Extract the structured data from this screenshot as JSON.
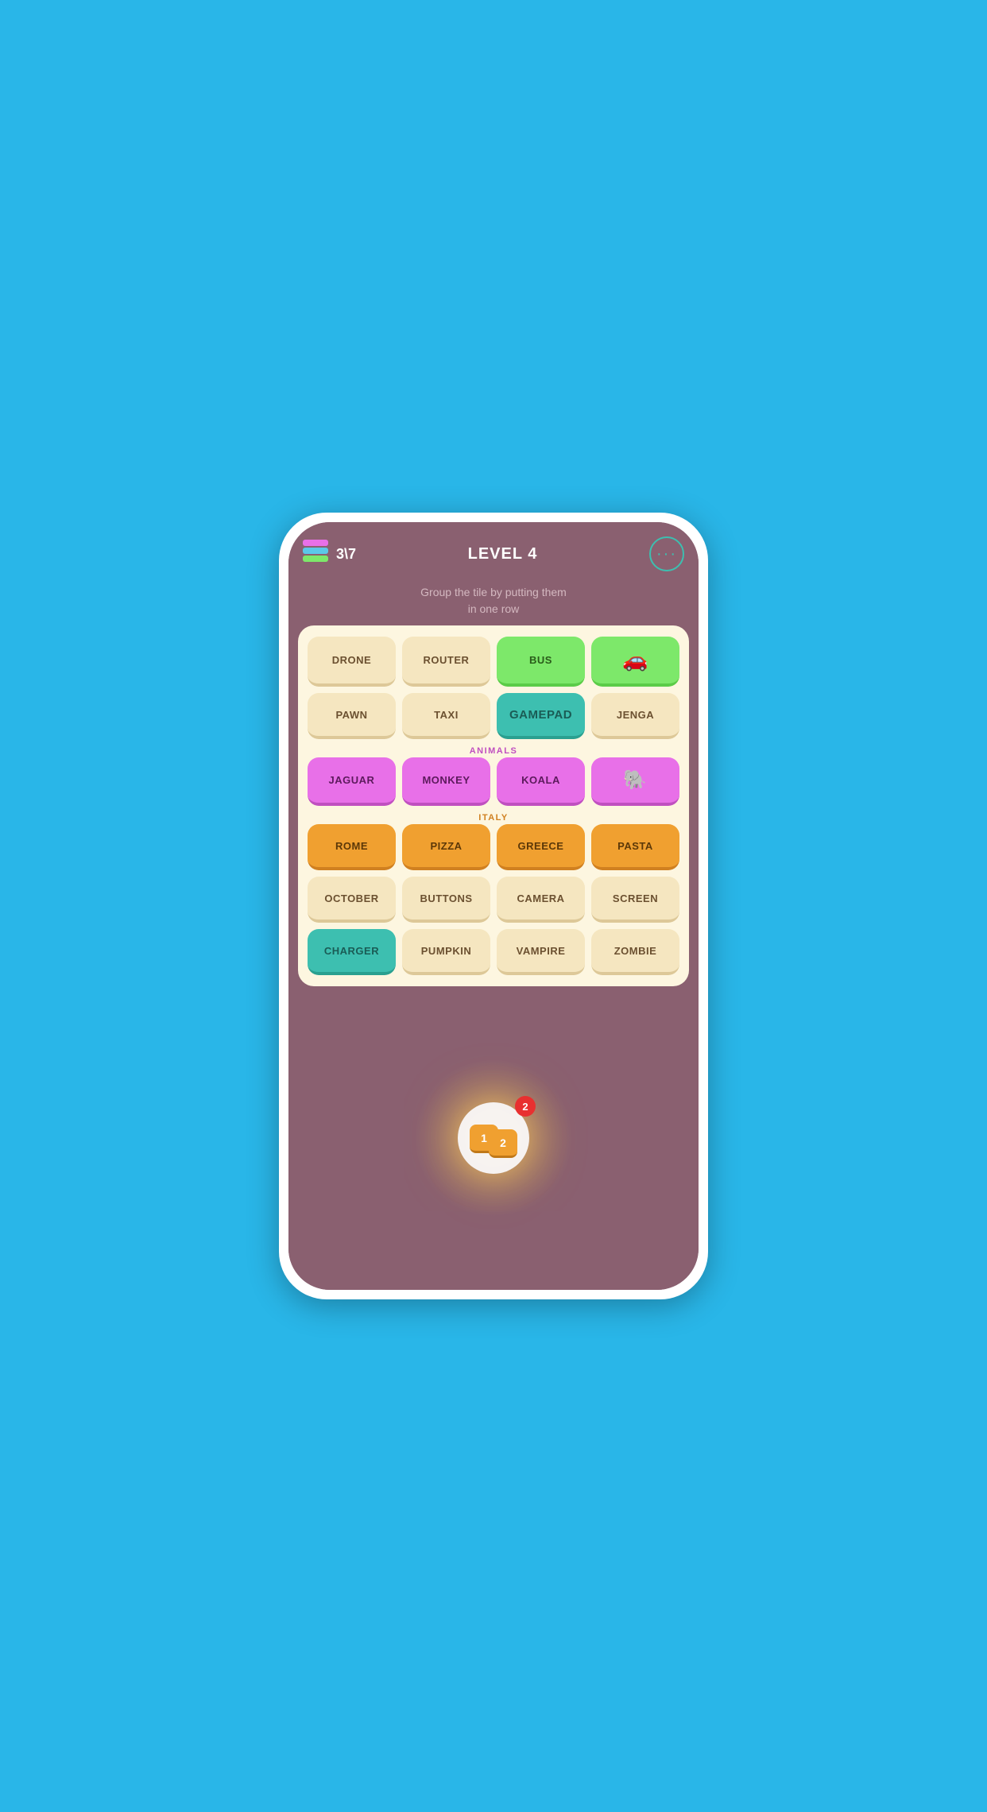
{
  "header": {
    "score": "3\\7",
    "level": "LEVEL 4",
    "menu_dots": "···"
  },
  "instruction": {
    "line1": "Group the tile by putting them",
    "line2": "in one row"
  },
  "grid": {
    "rows": [
      [
        {
          "label": "DRONE",
          "style": "cream"
        },
        {
          "label": "ROUTER",
          "style": "cream"
        },
        {
          "label": "BUS",
          "style": "green"
        },
        {
          "label": "🚗",
          "style": "green",
          "is_icon": true
        }
      ],
      [
        {
          "label": "PAWN",
          "style": "cream"
        },
        {
          "label": "TAXI",
          "style": "cream"
        },
        {
          "label": "GAMEPAD",
          "style": "teal"
        },
        {
          "label": "JENGA",
          "style": "cream"
        }
      ]
    ],
    "animals_group": {
      "label": "ANIMALS",
      "tiles": [
        {
          "label": "JAGUAR",
          "style": "pink"
        },
        {
          "label": "MONKEY",
          "style": "pink"
        },
        {
          "label": "KOALA",
          "style": "pink"
        },
        {
          "label": "🐘",
          "style": "pink",
          "is_icon": true
        }
      ]
    },
    "italy_group": {
      "label": "ITALY",
      "tiles": [
        {
          "label": "ROME",
          "style": "orange"
        },
        {
          "label": "PIZZA",
          "style": "orange"
        },
        {
          "label": "GREECE",
          "style": "orange"
        },
        {
          "label": "PASTA",
          "style": "orange"
        }
      ]
    },
    "row5": [
      {
        "label": "OCTOBER",
        "style": "cream"
      },
      {
        "label": "BUTTONS",
        "style": "cream"
      },
      {
        "label": "CAMERA",
        "style": "cream"
      },
      {
        "label": "SCREEN",
        "style": "cream"
      }
    ],
    "row6": [
      {
        "label": "CHARGER",
        "style": "teal-selected"
      },
      {
        "label": "PUMPKIN",
        "style": "cream"
      },
      {
        "label": "VAMPIRE",
        "style": "cream"
      },
      {
        "label": "ZOMBIE",
        "style": "cream"
      }
    ]
  },
  "hint": {
    "tile1_label": "1",
    "tile2_label": "2",
    "badge_count": "2"
  }
}
